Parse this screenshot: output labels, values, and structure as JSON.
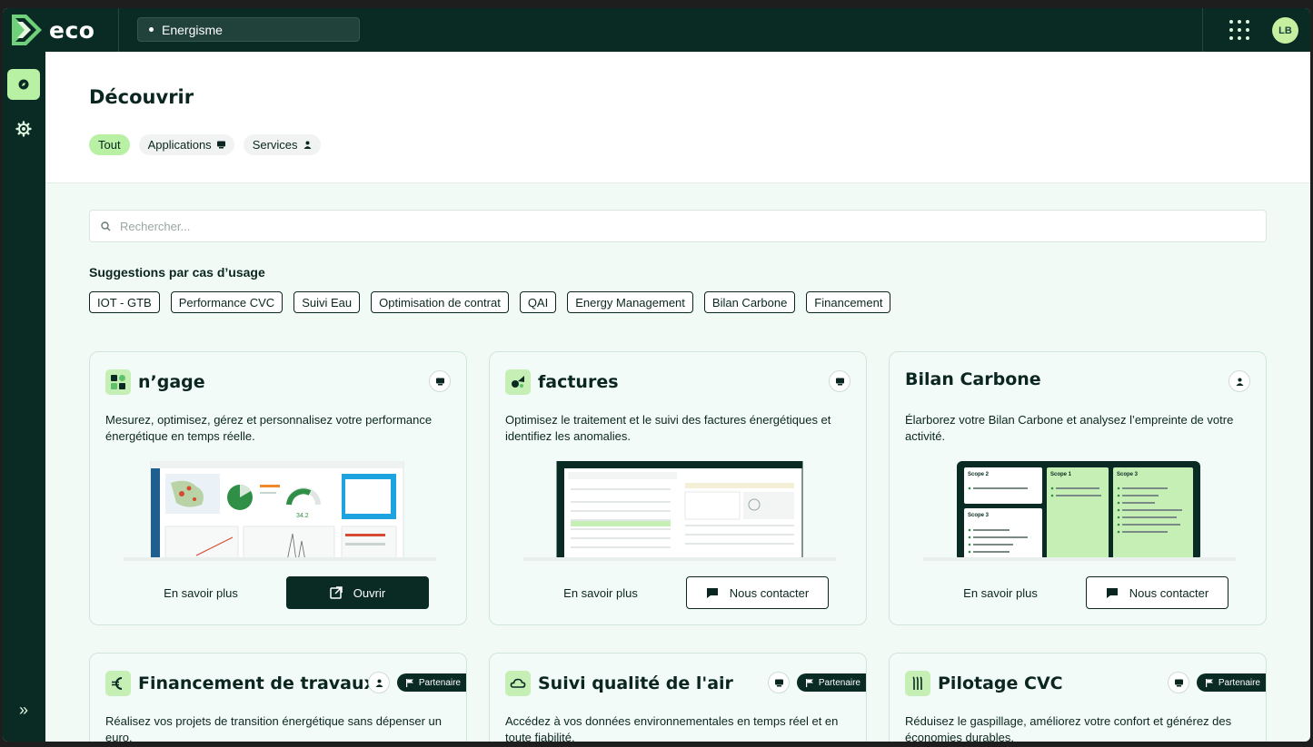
{
  "app": {
    "logo_text": "eco",
    "org": "Energisme",
    "avatar_initials": "LB"
  },
  "page": {
    "title": "Découvrir",
    "filters": [
      {
        "label": "Tout",
        "active": true
      },
      {
        "label": "Applications",
        "icon": "monitor-icon"
      },
      {
        "label": "Services",
        "icon": "person-icon"
      }
    ]
  },
  "search": {
    "placeholder": "Rechercher..."
  },
  "suggestions": {
    "title": "Suggestions par cas d’usage",
    "tags": [
      "IOT - GTB",
      "Performance CVC",
      "Suivi Eau",
      "Optimisation de contrat",
      "QAI",
      "Energy Management",
      "Bilan Carbone",
      "Financement"
    ]
  },
  "cards": [
    {
      "title": "n’gage",
      "type": "application",
      "description": "Mesurez, optimisez, gérez et personnalisez votre performance énergétique en temps réelle.",
      "link_label": "En savoir plus",
      "action_label": "Ouvrir",
      "preview": "dashboard"
    },
    {
      "title": "factures",
      "type": "application",
      "description": "Optimisez le traitement et le suivi des factures énergétiques et identifiez les anomalies.",
      "link_label": "En savoir plus",
      "action_label": "Nous contacter",
      "preview": "invoices"
    },
    {
      "title": "Bilan Carbone",
      "type": "service",
      "description": "Élarborez votre Bilan Carbone et analysez l’empreinte de votre activité.",
      "link_label": "En savoir plus",
      "action_label": "Nous contacter",
      "preview": "scopes"
    },
    {
      "title": "Financement de travaux",
      "type": "service",
      "badge": "Partenaire",
      "description": "Réalisez vos projets de transition énergétique sans dépenser un euro."
    },
    {
      "title": "Suivi qualité de l'air",
      "type": "application",
      "badge": "Partenaire",
      "description": "Accédez à vos données environnementales en temps réel et en toute fiabilité."
    },
    {
      "title": "Pilotage CVC",
      "type": "application",
      "badge": "Partenaire",
      "description": "Réduisez le gaspillage, améliorez votre confort et générez des économies durables."
    }
  ],
  "colors": {
    "brand_dark": "#0a2b24",
    "accent_green": "#b8f0a4",
    "card_bg": "#f2fbf7"
  }
}
